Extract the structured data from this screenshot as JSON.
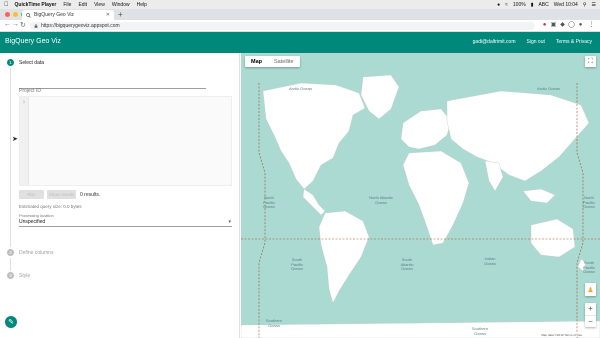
{
  "mac_menubar": {
    "app_name": "QuickTime Player",
    "menus": [
      "File",
      "Edit",
      "View",
      "Window",
      "Help"
    ],
    "battery": "100%",
    "input_source": "ABC",
    "clock": "Wed 10:04"
  },
  "browser": {
    "tab_title": "BigQuery Geo Viz",
    "url": "https://bigquerygeoviz.appspot.com"
  },
  "app": {
    "title": "BigQuery Geo Viz",
    "user_email": "gadi@daltrimit.com",
    "signout_label": "Sign out",
    "terms_label": "Terms & Privacy",
    "accent_color": "#00897b"
  },
  "steps": [
    {
      "num": "1",
      "label": "Select data"
    },
    {
      "num": "2",
      "label": "Define columns"
    },
    {
      "num": "3",
      "label": "Style"
    }
  ],
  "select_data": {
    "project_placeholder": "Project ID",
    "editor_line": "1",
    "run_label": "Run",
    "show_results_label": "Show results",
    "results_text": "0 results.",
    "estimate_text": "Estimated query size: 0.0 bytes",
    "processing_label": "Processing location",
    "processing_value": "Unspecified"
  },
  "map": {
    "tab_map": "Map",
    "tab_satellite": "Satellite",
    "attribution": "Map data ©2019   Terms of Use",
    "oceans": [
      "Arctic Ocean",
      "North Pacific Ocean",
      "North Atlantic Ocean",
      "South Pacific Ocean",
      "South Atlantic Ocean",
      "Indian Ocean",
      "Southern Ocean",
      "Southern Ocean",
      "Arctic Ocean",
      "North Pacific Ocean",
      "South Pacific Ocean"
    ]
  }
}
